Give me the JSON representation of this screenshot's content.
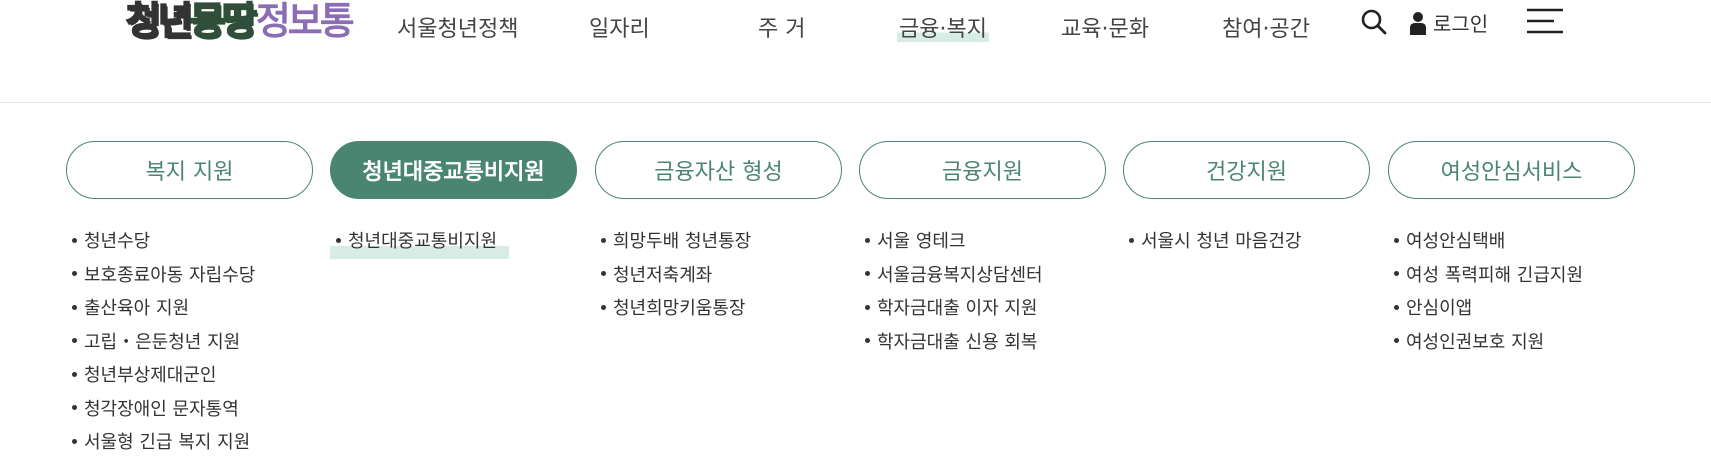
{
  "logo": {
    "part1": "청년",
    "part2": "몽땅",
    "part3": "정보통"
  },
  "nav": {
    "items": [
      {
        "label": "서울청년정책"
      },
      {
        "label": "일자리"
      },
      {
        "label": "주 거"
      },
      {
        "label": "금융·복지"
      },
      {
        "label": "교육·문화"
      },
      {
        "label": "참여·공간"
      }
    ],
    "active_index": 3,
    "login_label": "로그인"
  },
  "icons": {
    "search": "search-icon",
    "user": "user-icon",
    "menu": "hamburger-menu-icon"
  },
  "colors": {
    "accent": "#4a8572",
    "highlight": "#d6ece4",
    "logo_purple": "#8a6db5",
    "logo_green": "#7fbe8c"
  },
  "categories": [
    {
      "label": "복지 지원",
      "items": [
        "청년수당",
        "보호종료아동 자립수당",
        "출산육아 지원",
        "고립・은둔청년 지원",
        "청년부상제대군인",
        "청각장애인 문자통역",
        "서울형 긴급 복지 지원"
      ]
    },
    {
      "label": "청년대중교통비지원",
      "items": [
        "청년대중교통비지원"
      ]
    },
    {
      "label": "금융자산 형성",
      "items": [
        "희망두배 청년통장",
        "청년저축계좌",
        "청년희망키움통장"
      ]
    },
    {
      "label": "금융지원",
      "items": [
        "서울 영테크",
        "서울금융복지상담센터",
        "학자금대출 이자 지원",
        "학자금대출 신용 회복"
      ]
    },
    {
      "label": "건강지원",
      "items": [
        "서울시 청년 마음건강"
      ]
    },
    {
      "label": "여성안심서비스",
      "items": [
        "여성안심택배",
        "여성 폭력피해 긴급지원",
        "안심이앱",
        "여성인권보호 지원"
      ]
    }
  ],
  "active_category_index": 1
}
